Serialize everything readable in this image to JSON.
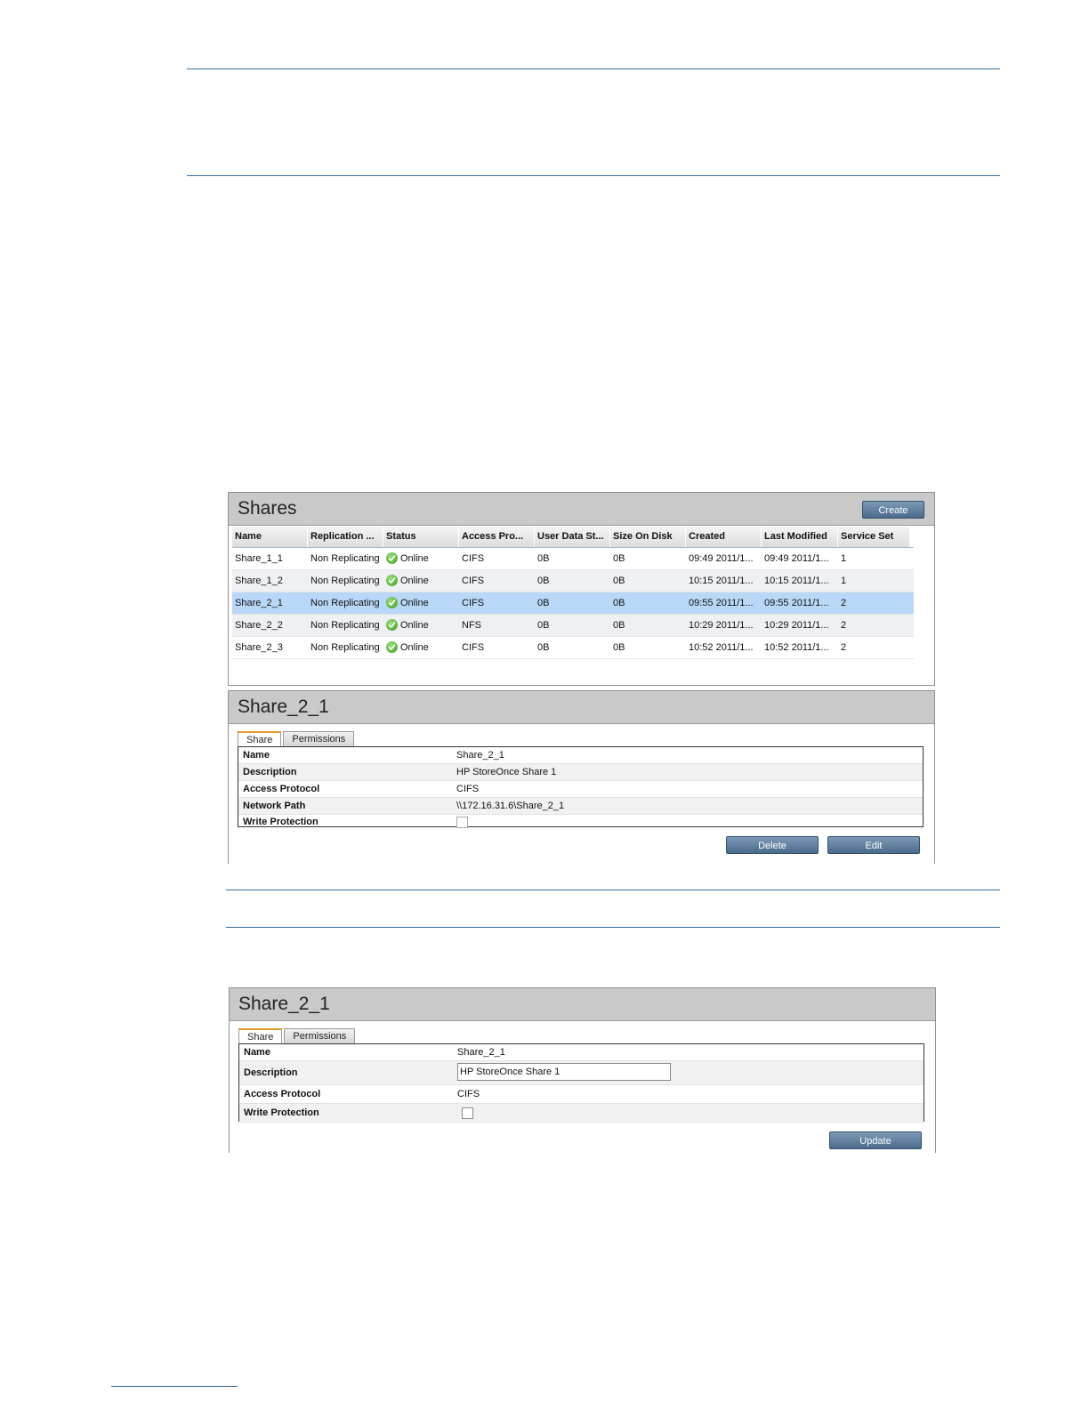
{
  "shares_panel": {
    "title": "Shares",
    "create_label": "Create",
    "columns": [
      "Name",
      "Replication ...",
      "Status",
      "Access Pro...",
      "User Data St...",
      "Size On Disk",
      "Created",
      "Last Modified",
      "Service Set"
    ],
    "rows": [
      {
        "name": "Share_1_1",
        "replication": "Non Replicating",
        "status": "Online",
        "protocol": "CIFS",
        "user_data": "0B",
        "size": "0B",
        "created": "09:49 2011/1...",
        "modified": "09:49 2011/1...",
        "service_set": "1"
      },
      {
        "name": "Share_1_2",
        "replication": "Non Replicating",
        "status": "Online",
        "protocol": "CIFS",
        "user_data": "0B",
        "size": "0B",
        "created": "10:15 2011/1...",
        "modified": "10:15 2011/1...",
        "service_set": "1"
      },
      {
        "name": "Share_2_1",
        "replication": "Non Replicating",
        "status": "Online",
        "protocol": "CIFS",
        "user_data": "0B",
        "size": "0B",
        "created": "09:55 2011/1...",
        "modified": "09:55 2011/1...",
        "service_set": "2"
      },
      {
        "name": "Share_2_2",
        "replication": "Non Replicating",
        "status": "Online",
        "protocol": "NFS",
        "user_data": "0B",
        "size": "0B",
        "created": "10:29 2011/1...",
        "modified": "10:29 2011/1...",
        "service_set": "2"
      },
      {
        "name": "Share_2_3",
        "replication": "Non Replicating",
        "status": "Online",
        "protocol": "CIFS",
        "user_data": "0B",
        "size": "0B",
        "created": "10:52 2011/1...",
        "modified": "10:52 2011/1...",
        "service_set": "2"
      }
    ]
  },
  "detail_panel": {
    "title": "Share_2_1",
    "tabs": [
      "Share",
      "Permissions"
    ],
    "props": [
      {
        "label": "Name",
        "value": "Share_2_1"
      },
      {
        "label": "Description",
        "value": "HP StoreOnce Share 1"
      },
      {
        "label": "Access Protocol",
        "value": "CIFS"
      },
      {
        "label": "Network Path",
        "value": "\\\\172.16.31.6\\Share_2_1"
      },
      {
        "label": "Write Protection",
        "value": ""
      }
    ],
    "delete_label": "Delete",
    "edit_label": "Edit"
  },
  "edit_panel": {
    "title": "Share_2_1",
    "tabs": [
      "Share",
      "Permissions"
    ],
    "props": [
      {
        "label": "Name",
        "value": "Share_2_1"
      },
      {
        "label": "Description",
        "value": "HP StoreOnce Share 1"
      },
      {
        "label": "Access Protocol",
        "value": "CIFS"
      },
      {
        "label": "Write Protection",
        "value": ""
      }
    ],
    "update_label": "Update"
  },
  "colors": {
    "rule": "#3a6d9c",
    "selected_row": "#b9d8f8",
    "button": "#4b6b8c",
    "status_ok": "#3c9a1f"
  }
}
